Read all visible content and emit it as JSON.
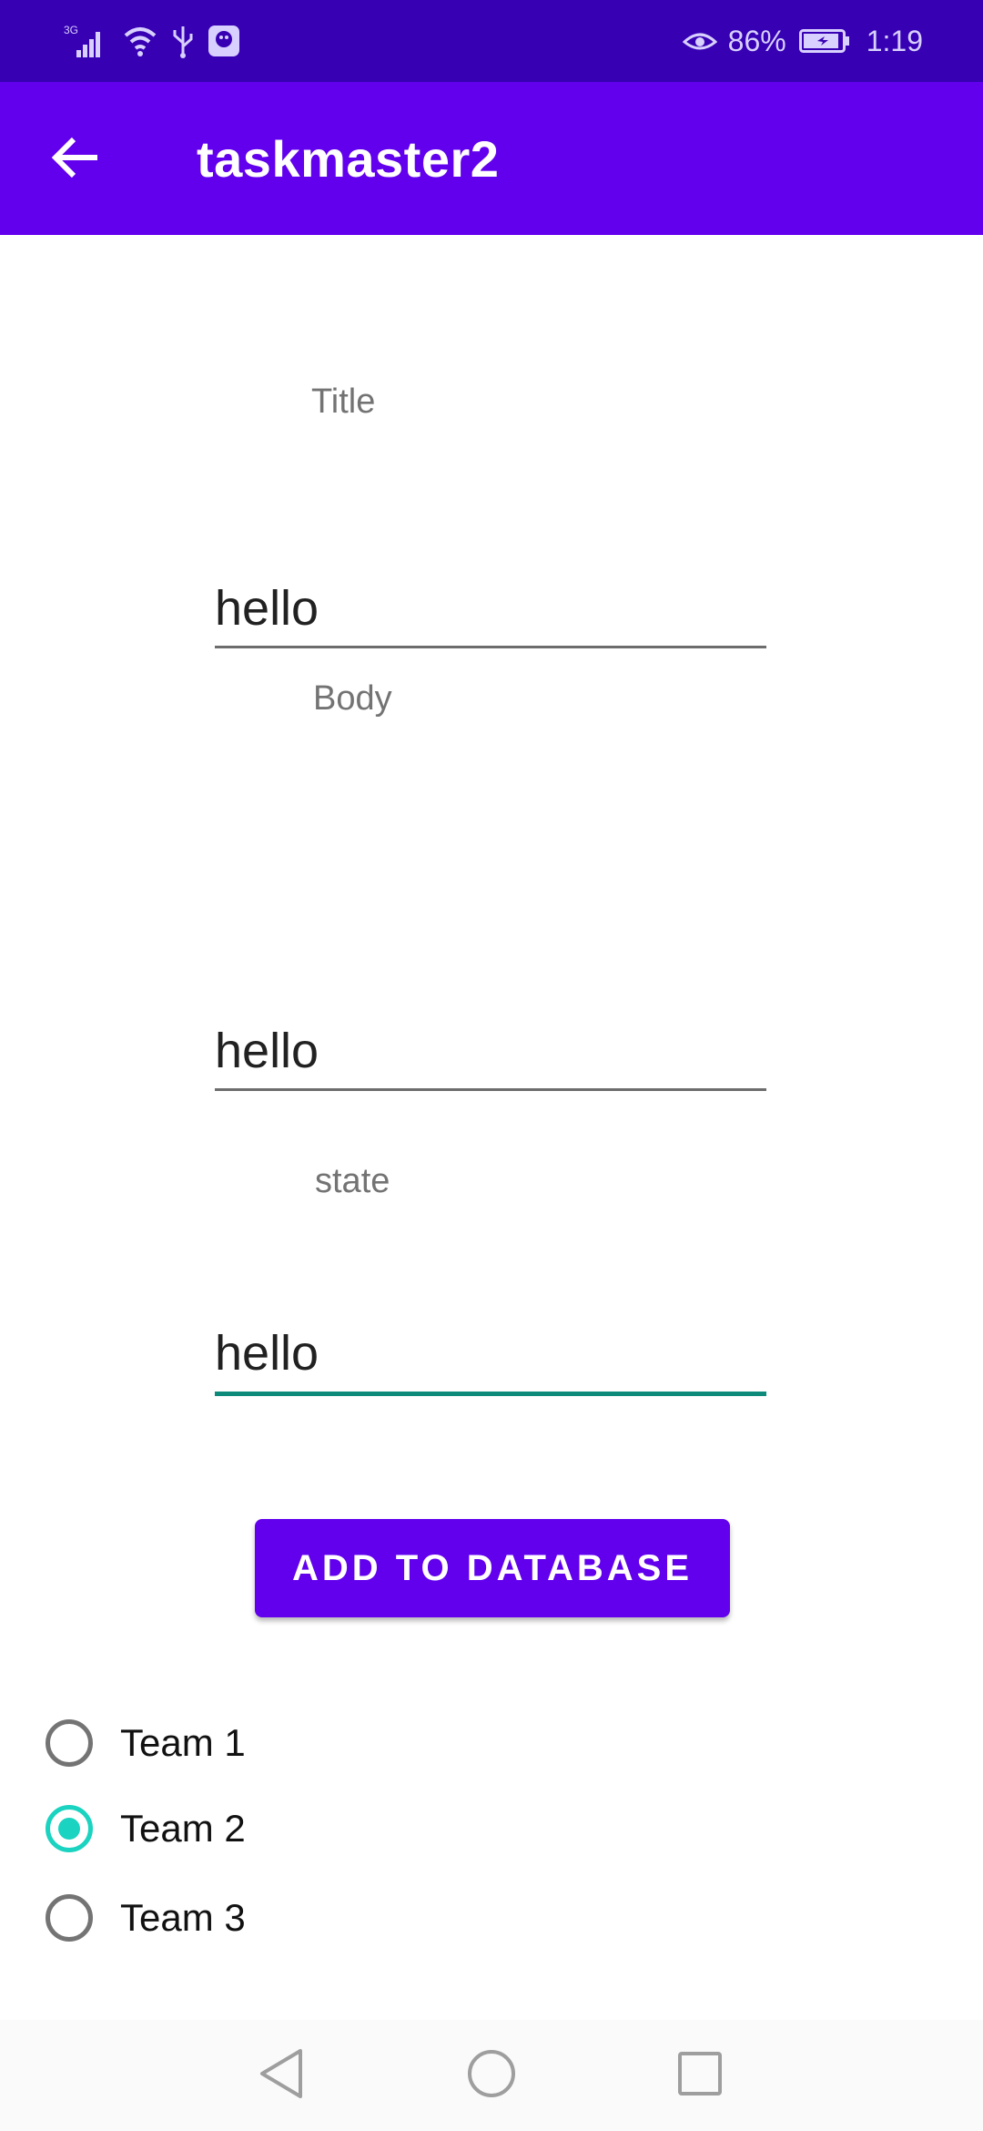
{
  "status_bar": {
    "network": "3G",
    "battery_percent": "86%",
    "time": "1:19"
  },
  "app_bar": {
    "title": "taskmaster2"
  },
  "form": {
    "title_label": "Title",
    "title_value": "hello",
    "body_label": "Body",
    "body_value": "hello",
    "state_label": "state",
    "state_value": "hello",
    "submit_label": "ADD TO DATABASE"
  },
  "teams": {
    "options": [
      {
        "label": "Team 1",
        "checked": false
      },
      {
        "label": "Team 2",
        "checked": true
      },
      {
        "label": "Team 3",
        "checked": false
      }
    ]
  },
  "colors": {
    "status_bar": "#3700b3",
    "primary": "#6200ee",
    "accent": "#1ad3c0",
    "focused_underline": "#0d8a7a"
  },
  "icons": {
    "back": "arrow-left-icon",
    "nav_back": "triangle-back-icon",
    "nav_home": "circle-home-icon",
    "nav_recents": "square-recents-icon"
  }
}
